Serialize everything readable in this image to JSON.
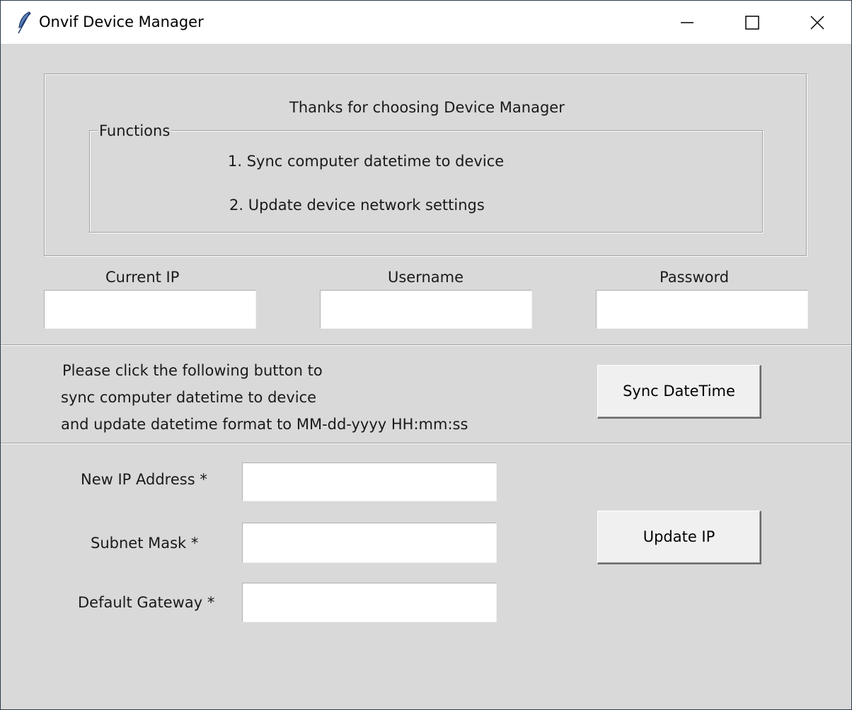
{
  "window": {
    "title": "Onvif Device Manager",
    "controls": [
      "minimize-icon",
      "maximize-icon",
      "close-icon"
    ]
  },
  "info": {
    "thanks_text": "Thanks for choosing Device Manager",
    "functions_label": "Functions",
    "function_1": "1. Sync computer datetime to device",
    "function_2": "2. Update device network settings"
  },
  "credentials": {
    "current_ip_label": "Current IP",
    "current_ip_value": "",
    "username_label": "Username",
    "username_value": "",
    "password_label": "Password",
    "password_value": ""
  },
  "sync": {
    "instruction_line_1": "Please click the following button to",
    "instruction_line_2": "sync computer datetime to device",
    "instruction_line_3": "and update datetime format to MM-dd-yyyy HH:mm:ss",
    "button_label": "Sync DateTime"
  },
  "network": {
    "new_ip_label": "New IP Address *",
    "new_ip_value": "",
    "subnet_label": "Subnet Mask *",
    "subnet_value": "",
    "gateway_label": "Default Gateway *",
    "gateway_value": "",
    "button_label": "Update IP"
  },
  "colors": {
    "background": "#d9d9d9",
    "titlebar": "#ffffff",
    "button_face": "#f0f0f0",
    "entry_background": "#ffffff"
  }
}
